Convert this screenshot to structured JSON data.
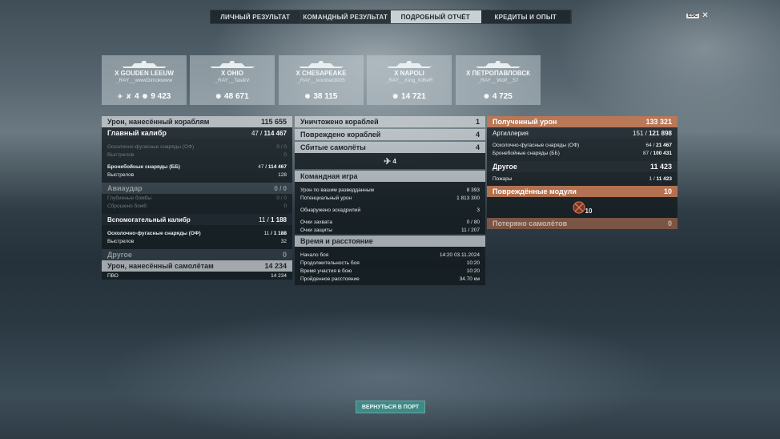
{
  "tabs": [
    "ЛИЧНЫЙ РЕЗУЛЬТАТ",
    "КОМАНДНЫЙ РЕЗУЛЬТАТ",
    "ПОДРОБНЫЙ ОТЧЁТ",
    "КРЕДИТЫ И ОПЫТ"
  ],
  "active_tab": "ПОДРОБНЫЙ ОТЧЁТ",
  "esc_label": "ESC",
  "ships": [
    {
      "name": "X GOUDEN LEEUW",
      "player": "_RAY__wwwDimokwww",
      "planes": "4",
      "damage": "9 423"
    },
    {
      "name": "X OHIO",
      "player": "_RAY__TasikV",
      "damage": "48 671"
    },
    {
      "name": "X CHESAPEAKE",
      "player": "_RAY__kombat3005",
      "damage": "38 115"
    },
    {
      "name": "X NAPOLI",
      "player": "_RAY__King_KiBeR",
      "damage": "14 721"
    },
    {
      "name": "X ПЕТРОПАВЛОВСК",
      "player": "_RAY__Wolf__57",
      "damage": "4 725"
    }
  ],
  "left": {
    "ship_damage": {
      "label": "Урон, нанесённый кораблям",
      "value": "115 655"
    },
    "main": {
      "label": "Главный калибр",
      "hits": "47",
      "shots": "114 467"
    },
    "main_he": {
      "label": "Осколочно-фугасные снаряды (ОФ)",
      "hits": "0",
      "total": "0"
    },
    "main_he_shots": {
      "label": "Выстрелов",
      "value": "0"
    },
    "main_ap": {
      "label": "Бронебойные снаряды (ББ)",
      "hits": "47",
      "total": "114 467"
    },
    "main_ap_shots": {
      "label": "Выстрелов",
      "value": "128"
    },
    "air": {
      "label": "Авиаудар",
      "hits": "0",
      "total": "0"
    },
    "air_bombs": {
      "label": "Глубинные бомбы",
      "hits": "0",
      "total": "0"
    },
    "air_dropped": {
      "label": "Сброшено бомб",
      "value": "0"
    },
    "secondary": {
      "label": "Вспомогательный калибр",
      "hits": "11",
      "total": "1 188"
    },
    "sec_he": {
      "label": "Осколочно-фугасные снаряды (ОФ)",
      "hits": "11",
      "total": "1 188"
    },
    "sec_shots": {
      "label": "Выстрелов",
      "value": "32"
    },
    "other": {
      "label": "Другое",
      "value": "0"
    },
    "plane_damage": {
      "label": "Урон, нанесённый самолётам",
      "value": "14 234"
    },
    "aa": {
      "label": "ПВО",
      "value": "14 234"
    }
  },
  "middle": {
    "destroyed": {
      "label": "Уничтожено кораблей",
      "value": "1"
    },
    "damaged": {
      "label": "Повреждено кораблей",
      "value": "4"
    },
    "planes": {
      "label": "Сбитые самолёты",
      "value": "4"
    },
    "planes_icon_value": "4",
    "team_title": "Командная игра",
    "spotting": {
      "label": "Урон по вашим разведданным",
      "value": "8 393"
    },
    "potential": {
      "label": "Потенциальный урон",
      "value": "1 813 300"
    },
    "squadrons": {
      "label": "Обнаружено эскадрилий",
      "value": "3"
    },
    "capture": {
      "label": "Очки захвата",
      "a": "0",
      "b": "80"
    },
    "defense": {
      "label": "Очки защиты",
      "a": "11",
      "b": "207"
    },
    "time_title": "Время и расстояние",
    "start": {
      "label": "Начало боя",
      "value": "14:20  03.11.2024"
    },
    "duration": {
      "label": "Продолжительность боя",
      "value": "10:20"
    },
    "participation": {
      "label": "Время участия в бою",
      "value": "10:20"
    },
    "distance": {
      "label": "Пройденное расстояние",
      "value": "34.70 км"
    }
  },
  "right": {
    "received": {
      "label": "Полученный урон",
      "value": "133 321"
    },
    "artillery": {
      "label": "Артиллерия",
      "a": "151",
      "b": "121 898"
    },
    "he": {
      "label": "Осколочно-фугасные снаряды (ОФ)",
      "a": "64",
      "b": "21 467"
    },
    "ap": {
      "label": "Бронебойные снаряды (ББ)",
      "a": "87",
      "b": "100 431"
    },
    "other": {
      "label": "Другое",
      "value": "11 423"
    },
    "fires": {
      "label": "Пожары",
      "a": "1",
      "b": "11 423"
    },
    "modules": {
      "label": "Повреждённые модули",
      "value": "10"
    },
    "modules_icon_value": "10",
    "lost_planes": {
      "label": "Потеряно самолётов",
      "value": "0"
    }
  },
  "return_button": "ВЕРНУТЬСЯ В ПОРТ",
  "colors": {
    "accent_orange": "#c87850",
    "teal_button": "#3f8a86",
    "active_tab": "#c8d0d4"
  }
}
